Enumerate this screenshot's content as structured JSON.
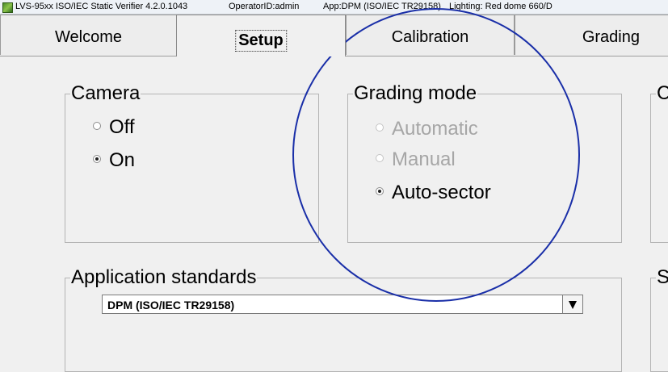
{
  "window": {
    "title": "LVS-95xx ISO/IEC Static Verifier 4.2.0.1043",
    "operator": "OperatorID:admin",
    "app": "App:DPM (ISO/IEC TR29158)",
    "lighting": "Lighting: Red dome 660/D"
  },
  "tabs": [
    {
      "label": "Welcome",
      "active": false
    },
    {
      "label": "Setup",
      "active": true
    },
    {
      "label": "Calibration",
      "active": false
    },
    {
      "label": "Grading",
      "active": false
    }
  ],
  "camera": {
    "legend": "Camera",
    "options": [
      {
        "label": "Off",
        "selected": false,
        "enabled": true
      },
      {
        "label": "On",
        "selected": true,
        "enabled": true
      }
    ]
  },
  "grading_mode": {
    "legend": "Grading mode",
    "options": [
      {
        "label": "Automatic",
        "selected": false,
        "enabled": false
      },
      {
        "label": "Manual",
        "selected": false,
        "enabled": false
      },
      {
        "label": "Auto-sector",
        "selected": true,
        "enabled": true
      }
    ]
  },
  "partial_groups": {
    "top_right_legend": "C",
    "bottom_right_legend": "S"
  },
  "application_standards": {
    "legend": "Application standards",
    "selected": "DPM (ISO/IEC TR29158)"
  },
  "annotation": {
    "shape": "oval",
    "color": "#1a2fa8"
  }
}
